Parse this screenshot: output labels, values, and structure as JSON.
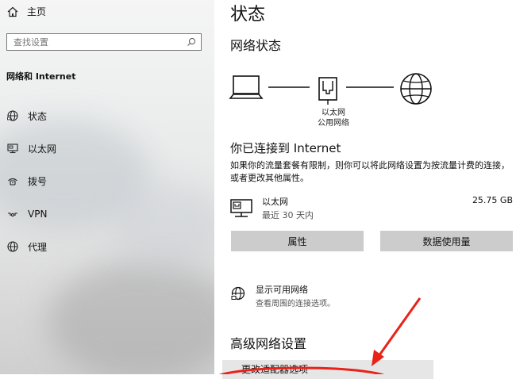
{
  "sidebar": {
    "home_label": "主页",
    "search_placeholder": "查找设置",
    "section_title": "网络和 Internet",
    "items": [
      {
        "label": "状态",
        "icon": "globe-status-icon"
      },
      {
        "label": "以太网",
        "icon": "ethernet-monitor-icon"
      },
      {
        "label": "拨号",
        "icon": "dialup-icon"
      },
      {
        "label": "VPN",
        "icon": "vpn-icon"
      },
      {
        "label": "代理",
        "icon": "globe-icon"
      }
    ]
  },
  "main": {
    "page_title": "状态",
    "network_status_heading": "网络状态",
    "diagram_label_line1": "以太网",
    "diagram_label_line2": "公用网络",
    "connected_title": "你已连接到 Internet",
    "description": "如果你的流量套餐有限制，则你可以将此网络设置为按流量计费的连接，或者更改其他属性。",
    "ethernet": {
      "name": "以太网",
      "subtitle": "最近 30 天内",
      "data_used": "25.75 GB"
    },
    "buttons": {
      "properties": "属性",
      "data_usage": "数据使用量"
    },
    "show_networks": {
      "title": "显示可用网络",
      "subtitle": "查看周围的连接选项。"
    },
    "advanced_heading": "高级网络设置",
    "advanced_item_label": "更改适配器选项"
  },
  "colors": {
    "annotation_arrow": "#e8231a",
    "button_bg": "#cccccc"
  }
}
